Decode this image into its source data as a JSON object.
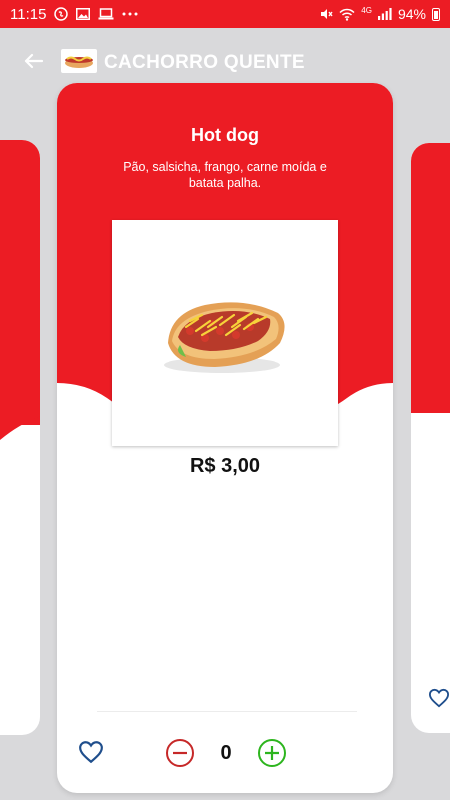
{
  "status_bar": {
    "time": "11:15",
    "battery": "94%",
    "network": "4G",
    "left_icons": [
      "shazam-icon",
      "image-icon",
      "laptop-icon",
      "more-dots-icon"
    ],
    "right_icons": [
      "mute-icon",
      "wifi-icon",
      "signal-icon",
      "battery-icon"
    ]
  },
  "header": {
    "title": "CACHORRO QUENTE",
    "back_icon": "arrow-left-icon"
  },
  "product": {
    "name": "Hot dog",
    "description": "Pão, salsicha, frango, carne moída e batata palha.",
    "price": "R$ 3,00",
    "quantity": "0"
  },
  "colors": {
    "primary_red": "#ec1c24",
    "minus_red": "#c62828",
    "plus_green": "#2db51e",
    "heart_blue": "#1f4e8c"
  }
}
